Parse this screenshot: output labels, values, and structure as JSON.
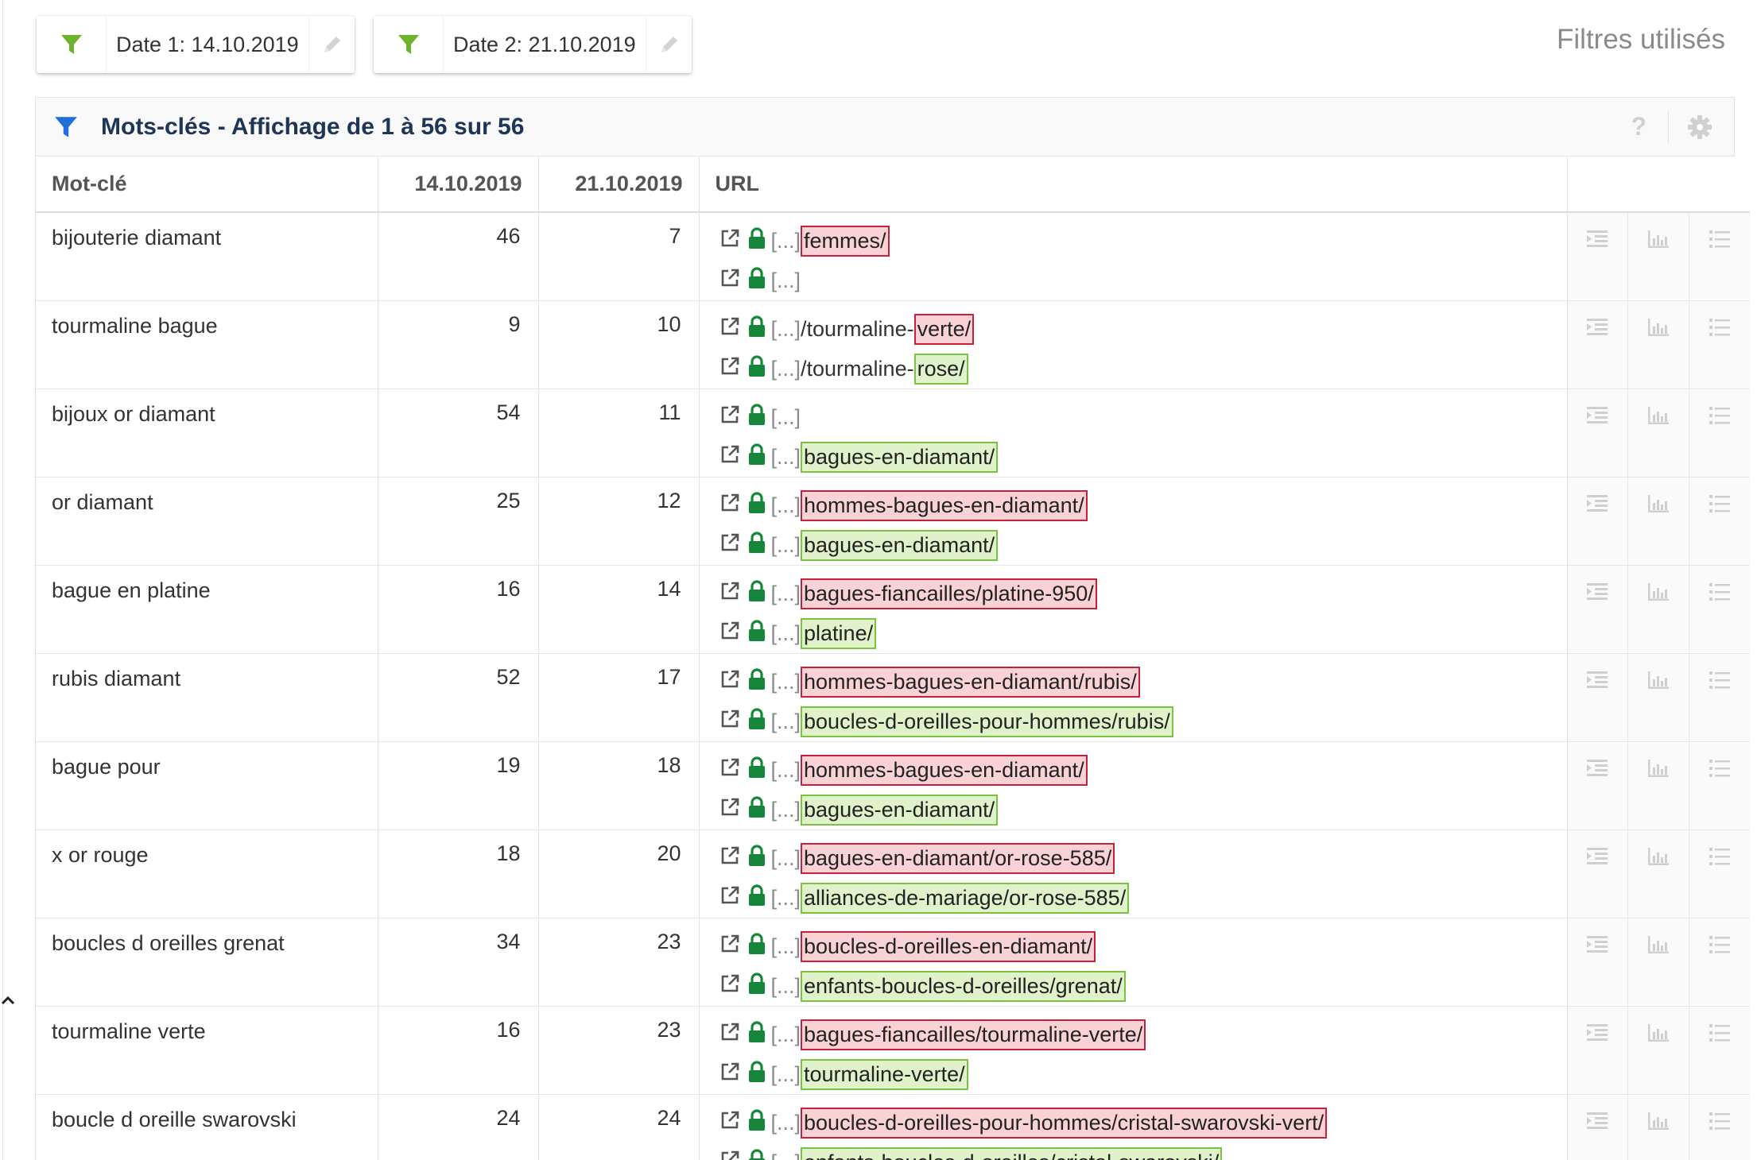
{
  "filters": [
    {
      "label": "Date 1: 14.10.2019"
    },
    {
      "label": "Date 2: 21.10.2019"
    }
  ],
  "filters_used": "Filtres utilisés",
  "panel": {
    "title": "Mots-clés - Affichage de 1 à 56 sur 56",
    "help": "?"
  },
  "columns": {
    "keyword": "Mot-clé",
    "date1": "14.10.2019",
    "date2": "21.10.2019",
    "url": "URL"
  },
  "url_prefix": "[...]",
  "rows": [
    {
      "keyword": "bijouterie diamant",
      "d1": "46",
      "d2": "7",
      "urls": [
        {
          "pre": "",
          "path": "femmes/",
          "state": "red"
        },
        {
          "pre": "",
          "path": "",
          "state": "none"
        }
      ]
    },
    {
      "keyword": "tourmaline bague",
      "d1": "9",
      "d2": "10",
      "urls": [
        {
          "pre": "/tourmaline-",
          "path": "verte/",
          "state": "red"
        },
        {
          "pre": "/tourmaline-",
          "path": "rose/",
          "state": "green"
        }
      ]
    },
    {
      "keyword": "bijoux or diamant",
      "d1": "54",
      "d2": "11",
      "urls": [
        {
          "pre": "",
          "path": "",
          "state": "none"
        },
        {
          "pre": "",
          "path": "bagues-en-diamant/",
          "state": "green"
        }
      ]
    },
    {
      "keyword": "or diamant",
      "d1": "25",
      "d2": "12",
      "urls": [
        {
          "pre": "",
          "path": "hommes-bagues-en-diamant/",
          "state": "red"
        },
        {
          "pre": "",
          "path": "bagues-en-diamant/",
          "state": "green"
        }
      ]
    },
    {
      "keyword": "bague en platine",
      "d1": "16",
      "d2": "14",
      "urls": [
        {
          "pre": "",
          "path": "bagues-fiancailles/platine-950/",
          "state": "red"
        },
        {
          "pre": "",
          "path": "platine/",
          "state": "green"
        }
      ]
    },
    {
      "keyword": "rubis diamant",
      "d1": "52",
      "d2": "17",
      "urls": [
        {
          "pre": "",
          "path": "hommes-bagues-en-diamant/rubis/",
          "state": "red"
        },
        {
          "pre": "",
          "path": "boucles-d-oreilles-pour-hommes/rubis/",
          "state": "green"
        }
      ]
    },
    {
      "keyword": "bague pour",
      "d1": "19",
      "d2": "18",
      "urls": [
        {
          "pre": "",
          "path": "hommes-bagues-en-diamant/",
          "state": "red"
        },
        {
          "pre": "",
          "path": "bagues-en-diamant/",
          "state": "green"
        }
      ]
    },
    {
      "keyword": "x or rouge",
      "d1": "18",
      "d2": "20",
      "urls": [
        {
          "pre": "",
          "path": "bagues-en-diamant/or-rose-585/",
          "state": "red"
        },
        {
          "pre": "",
          "path": "alliances-de-mariage/or-rose-585/",
          "state": "green"
        }
      ]
    },
    {
      "keyword": "boucles d oreilles grenat",
      "d1": "34",
      "d2": "23",
      "urls": [
        {
          "pre": "",
          "path": "boucles-d-oreilles-en-diamant/",
          "state": "red"
        },
        {
          "pre": "",
          "path": "enfants-boucles-d-oreilles/grenat/",
          "state": "green"
        }
      ]
    },
    {
      "keyword": "tourmaline verte",
      "d1": "16",
      "d2": "23",
      "urls": [
        {
          "pre": "",
          "path": "bagues-fiancailles/tourmaline-verte/",
          "state": "red"
        },
        {
          "pre": "",
          "path": "tourmaline-verte/",
          "state": "green"
        }
      ]
    },
    {
      "keyword": "boucle d oreille swarovski",
      "d1": "24",
      "d2": "24",
      "urls": [
        {
          "pre": "",
          "path": "boucles-d-oreilles-pour-hommes/cristal-swarovski-vert/",
          "state": "red"
        },
        {
          "pre": "",
          "path": "enfants-boucles-d-oreilles/cristal-swarovski/",
          "state": "green"
        }
      ]
    }
  ],
  "icons": {
    "filter": "funnel-icon",
    "edit": "pencil-icon",
    "external": "external-link-icon",
    "lock": "lock-icon",
    "indent": "indent-list-icon",
    "chart": "bar-chart-icon",
    "list": "bullet-list-icon",
    "gear": "gear-icon"
  },
  "colors": {
    "filter_green": "#6cb42c",
    "panel_funnel": "#1e6fd9",
    "title_navy": "#1d3557",
    "lock_green": "#16873a",
    "red_highlight": "#f9d2d6",
    "red_border": "#c5213a",
    "green_highlight": "#dff2c9",
    "green_border": "#7bc142"
  }
}
